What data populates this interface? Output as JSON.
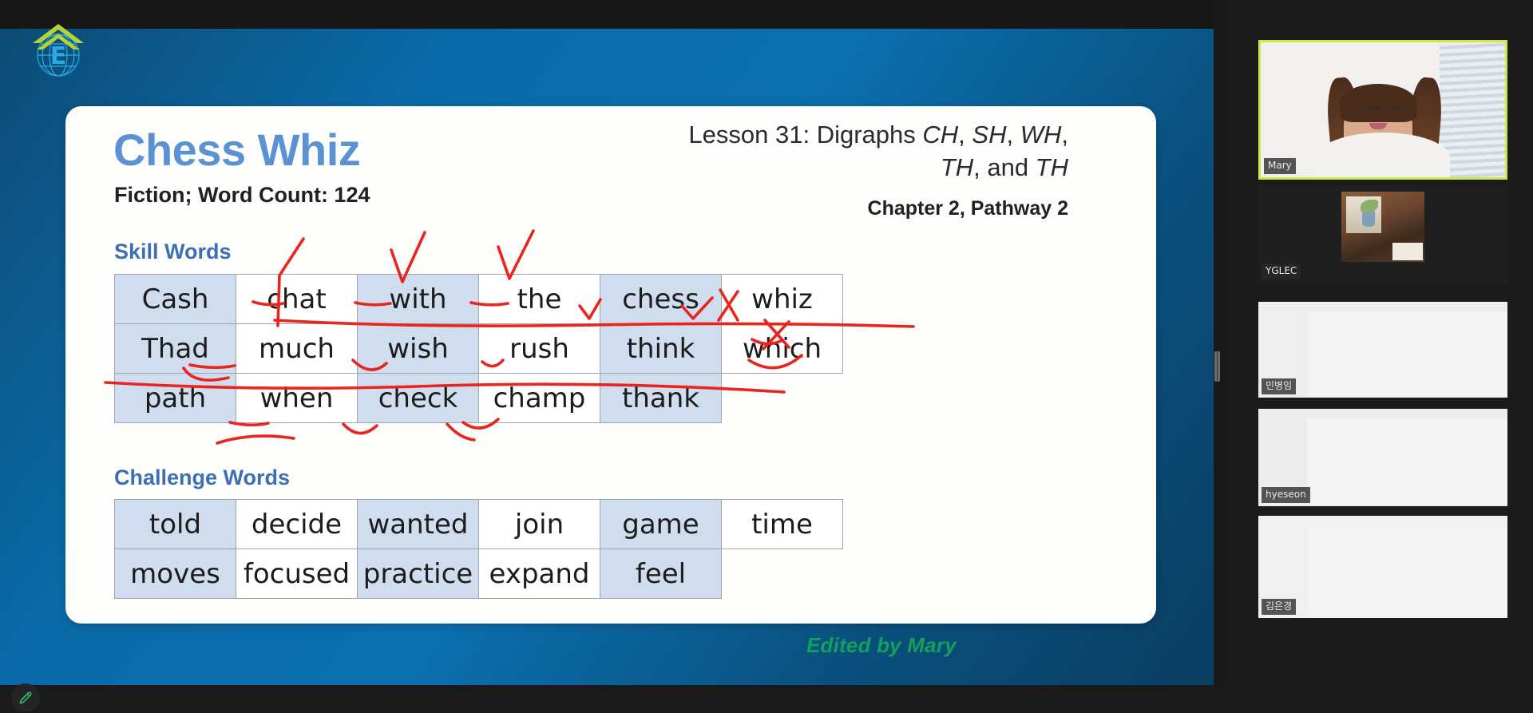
{
  "slide": {
    "title": "Chess Whiz",
    "subtitle": "Fiction; Word Count: 124",
    "lesson_line_1": "Lesson 31: Digraphs ",
    "lesson_ch": "CH",
    "lesson_comma_1": ",",
    "lesson_sh": "SH",
    "lesson_comma_2": ", ",
    "lesson_wh": "WH",
    "lesson_comma_3": ", ",
    "lesson_th1": "TH",
    "lesson_and": ", and ",
    "lesson_th2": "TH",
    "chapter": "Chapter 2, Pathway 2",
    "skill_words_label": "Skill Words",
    "challenge_words_label": "Challenge Words",
    "credit": "Edited by Mary",
    "accent_title_color": "#5b92d4",
    "accent_section_color": "#3c6fb4",
    "credit_color": "#12a05a",
    "table_shade_color": "#cfddee",
    "ink_color": "#e8251f"
  },
  "skill_words": {
    "rows": [
      [
        {
          "text": "Cash",
          "shaded": true
        },
        {
          "text": "chat",
          "shaded": false
        },
        {
          "text": "with",
          "shaded": true
        },
        {
          "text": "the",
          "shaded": false
        },
        {
          "text": "chess",
          "shaded": true
        },
        {
          "text": "whiz",
          "shaded": false
        }
      ],
      [
        {
          "text": "Thad",
          "shaded": true
        },
        {
          "text": "much",
          "shaded": false
        },
        {
          "text": "wish",
          "shaded": true
        },
        {
          "text": "rush",
          "shaded": false
        },
        {
          "text": "think",
          "shaded": true
        },
        {
          "text": "which",
          "shaded": false
        }
      ],
      [
        {
          "text": "path",
          "shaded": true
        },
        {
          "text": "when",
          "shaded": false
        },
        {
          "text": "check",
          "shaded": true
        },
        {
          "text": "champ",
          "shaded": false
        },
        {
          "text": "thank",
          "shaded": true
        },
        {
          "text": "",
          "shaded": false,
          "empty": true
        }
      ]
    ]
  },
  "challenge_words": {
    "rows": [
      [
        {
          "text": "told",
          "shaded": true
        },
        {
          "text": "decide",
          "shaded": false
        },
        {
          "text": "wanted",
          "shaded": true
        },
        {
          "text": "join",
          "shaded": false
        },
        {
          "text": "game",
          "shaded": true
        },
        {
          "text": "time",
          "shaded": false
        }
      ],
      [
        {
          "text": "moves",
          "shaded": true
        },
        {
          "text": "focused",
          "shaded": false
        },
        {
          "text": "practice",
          "shaded": true
        },
        {
          "text": "expand",
          "shaded": false
        },
        {
          "text": "feel",
          "shaded": true
        },
        {
          "text": "",
          "shaded": false,
          "empty": true
        }
      ]
    ]
  },
  "annotations": {
    "tool": "red-pen",
    "description": "Hand-drawn red ink: underlines on digraphs, check marks, and long horizontal strike lines across rows"
  },
  "toolbar": {
    "pen_tool_name": "pen-tool",
    "pen_color": "#2ecc71"
  },
  "video_rail": {
    "tiles": [
      {
        "name": "Mary",
        "active_speaker": true,
        "camera_on": true,
        "kind": "webcam"
      },
      {
        "name": "YGLEC",
        "active_speaker": false,
        "camera_on": true,
        "kind": "avatar"
      },
      {
        "name": "민병임",
        "active_speaker": false,
        "camera_on": true,
        "kind": "blank"
      },
      {
        "name": "hyeseon",
        "active_speaker": false,
        "camera_on": true,
        "kind": "blank"
      },
      {
        "name": "김은경",
        "active_speaker": false,
        "camera_on": true,
        "kind": "blank"
      }
    ],
    "active_border_color": "#cfe849"
  }
}
